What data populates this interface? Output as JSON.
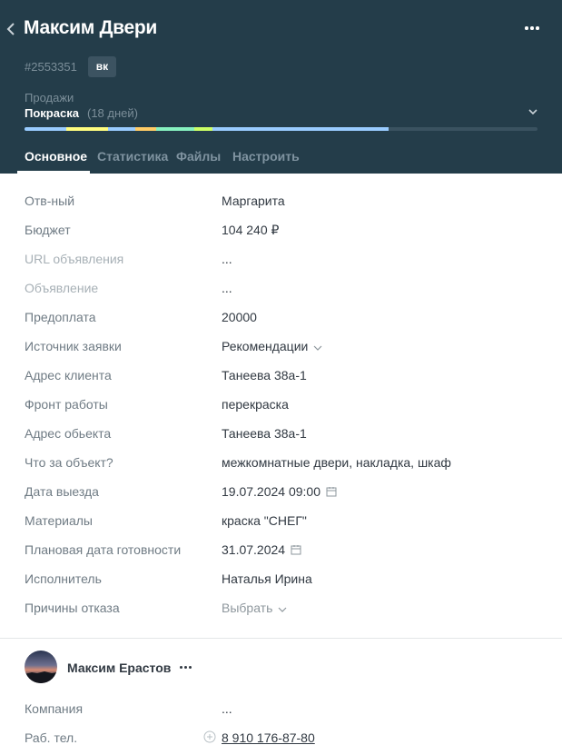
{
  "header": {
    "title": "Максим Двери",
    "lead_id": "#2553351",
    "source_badge": "вк",
    "pipeline": "Продажи",
    "stage": "Покраска",
    "stage_days": "(18 дней)",
    "icons": {
      "back": "chevron-left-icon",
      "more": "more-horizontal-icon",
      "stage_toggle": "chevron-down-icon"
    },
    "stage_progress": 0.71,
    "stage_colors": [
      "#99ccff",
      "#fffd7f",
      "#99ccff",
      "#ffcc66",
      "#87f2c0",
      "#ccff66",
      "#99ccff"
    ]
  },
  "tabs": [
    {
      "label": "Основное",
      "active": true
    },
    {
      "label": "Статистика",
      "active": false
    },
    {
      "label": "Файлы",
      "active": false
    },
    {
      "label": "Настроить",
      "active": false
    }
  ],
  "fields": [
    {
      "label": "Отв-ный",
      "value": "Маргарита"
    },
    {
      "label": "Бюджет",
      "value": "104 240 ₽"
    },
    {
      "label": "URL объявления",
      "value": "..."
    },
    {
      "label": "Объявление",
      "value": "..."
    },
    {
      "label": "Предоплата",
      "value": "20000"
    },
    {
      "label": "Источник заявки",
      "value": "Рекомендации"
    },
    {
      "label": "Адрес клиента",
      "value": "Танеева 38а-1"
    },
    {
      "label": "Фронт работы",
      "value": "перекраска"
    },
    {
      "label": "Адрес обьекта",
      "value": "Танеева 38а-1"
    },
    {
      "label": "Что за объект?",
      "value": "межкомнатные двери, накладка, шкаф"
    },
    {
      "label": "Дата выезда",
      "value": "19.07.2024 09:00"
    },
    {
      "label": "Материалы",
      "value": "краска \"СНЕГ\""
    },
    {
      "label": "Плановая дата готовности",
      "value": "31.07.2024"
    },
    {
      "label": "Исполнитель",
      "value": "Наталья Ирина"
    },
    {
      "label": "Причины отказа",
      "value": "Выбрать"
    }
  ],
  "contact": {
    "name": "Максим Ерастов",
    "company_label": "Компания",
    "company_value": "...",
    "phone_label": "Раб. тел.",
    "phone_value": "8 910 176-87-80"
  },
  "colors": {
    "header_bg": "#243d4a",
    "label": "#6f7b84",
    "text": "#313942"
  }
}
